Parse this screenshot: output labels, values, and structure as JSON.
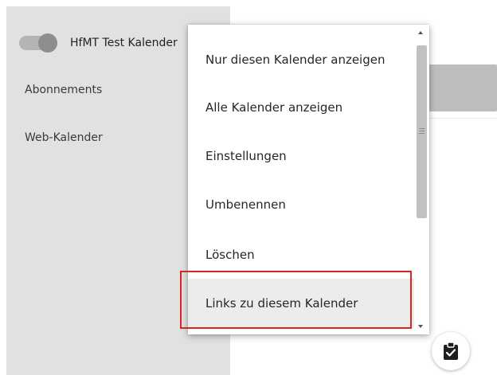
{
  "sidebar": {
    "calendar": {
      "name": "HfMT Test Kalender",
      "enabled": true
    },
    "nav": [
      {
        "label": "Abonnements"
      },
      {
        "label": "Web-Kalender"
      }
    ]
  },
  "context_menu": {
    "items": [
      {
        "label": "Nur diesen Kalender anzeigen"
      },
      {
        "label": "Alle Kalender anzeigen"
      },
      {
        "label": "Einstellungen"
      },
      {
        "label": "Umbenennen"
      },
      {
        "label": "Löschen"
      },
      {
        "label": "Links zu diesem Kalender",
        "hovered": true,
        "highlighted": true
      }
    ]
  },
  "fab": {
    "icon": "clipboard-check-icon"
  },
  "colors": {
    "sidebar_bg": "#e1e1e1",
    "highlight_border": "#d7261f",
    "hover_bg": "#ececec"
  }
}
